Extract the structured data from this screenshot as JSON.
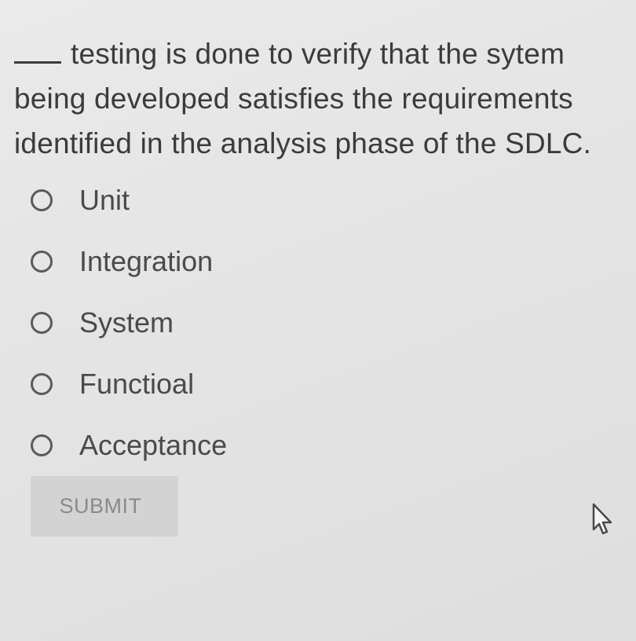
{
  "question": {
    "blank": "____",
    "text": "testing is done to verify that the sytem being developed satisfies the requirements identified in the analysis phase of the SDLC."
  },
  "options": [
    {
      "label": "Unit",
      "selected": false
    },
    {
      "label": "Integration",
      "selected": false
    },
    {
      "label": "System",
      "selected": false
    },
    {
      "label": "Functioal",
      "selected": false
    },
    {
      "label": "Acceptance",
      "selected": false
    }
  ],
  "submit": {
    "label": "SUBMIT",
    "enabled": false
  },
  "cursor": {
    "icon": "mouse-pointer-icon"
  },
  "colors": {
    "background": "#e4e4e4",
    "text": "#3b3b3b",
    "button_bg": "#d3d3d3",
    "button_text": "#8a8a8a"
  }
}
